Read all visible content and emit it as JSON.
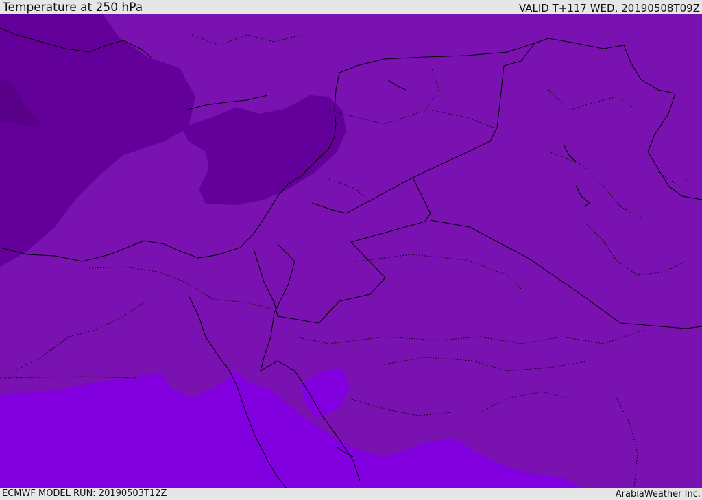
{
  "header": {
    "title": "Temperature at 250 hPa",
    "valid": "VALID T+117 WED, 20190508T09Z"
  },
  "footer": {
    "model_run": "ECMWF MODEL RUN: 20190503T12Z",
    "credit": "ArabiaWeather Inc."
  },
  "map": {
    "colors": {
      "base": "#7912b0",
      "cold_core": "#64009a",
      "coldest": "#580088",
      "warm": "#8200e0",
      "border": "#000000"
    }
  }
}
